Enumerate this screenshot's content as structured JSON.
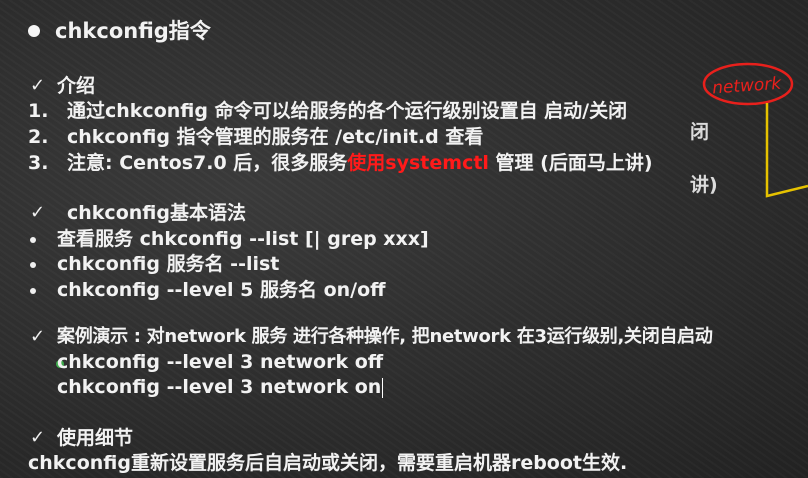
{
  "title": "chkconfig指令",
  "intro": {
    "heading": "介绍",
    "items": [
      {
        "num": "1.",
        "text": "通过chkconfig 命令可以给服务的各个运行级别设置自 启动/关闭"
      },
      {
        "num": "2.",
        "text": "chkconfig 指令管理的服务在 /etc/init.d 查看"
      },
      {
        "num": "3.",
        "pre": "注意: Centos7.0 后，很多服务",
        "highlight": "使用systemctl",
        "post": " 管理 (后面马上讲)"
      }
    ]
  },
  "syntax": {
    "heading": "chkconfig基本语法",
    "items": [
      "查看服务 chkconfig     --list [| grep  xxx]",
      "chkconfig   服务名   --list",
      "chkconfig   --level  5   服务名   on/off"
    ]
  },
  "example": {
    "heading": "案例演示 : 对network 服务  进行各种操作, 把network 在3运行级别,关闭自启动",
    "commands": [
      "chkconfig --level 3 network off",
      "chkconfig --level 3 network on"
    ]
  },
  "details": {
    "heading": "使用细节",
    "text": "chkconfig重新设置服务后自启动或关闭，需要重启机器reboot生效."
  },
  "background_fragments": [
    "闭",
    "讲)"
  ],
  "annotation": {
    "text": "network",
    "color": "#e8201c"
  },
  "colors": {
    "highlight": "#ff1a1a",
    "annotation_line": "#e6c200"
  }
}
